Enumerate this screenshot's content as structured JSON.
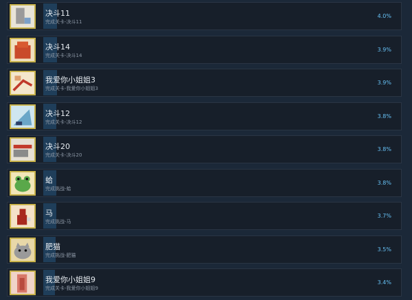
{
  "achievements": [
    {
      "title": "决斗11",
      "desc": "完成关卡-决斗11",
      "percent": "4.0%",
      "icon": "duel-11-icon",
      "percent_value": 4.0
    },
    {
      "title": "决斗14",
      "desc": "完成关卡-决斗14",
      "percent": "3.9%",
      "icon": "duel-14-icon",
      "percent_value": 3.9
    },
    {
      "title": "我爱你小姐姐3",
      "desc": "完成关卡-我爱你小姐姐3",
      "percent": "3.9%",
      "icon": "love-3-icon",
      "percent_value": 3.9
    },
    {
      "title": "决斗12",
      "desc": "完成关卡-决斗12",
      "percent": "3.8%",
      "icon": "duel-12-icon",
      "percent_value": 3.8
    },
    {
      "title": "决斗20",
      "desc": "完成关卡-决斗20",
      "percent": "3.8%",
      "icon": "duel-20-icon",
      "percent_value": 3.8
    },
    {
      "title": "蛤",
      "desc": "完成挑战-蛤",
      "percent": "3.8%",
      "icon": "frog-icon",
      "percent_value": 3.8
    },
    {
      "title": "马",
      "desc": "完成挑战-马",
      "percent": "3.7%",
      "icon": "horse-icon",
      "percent_value": 3.7
    },
    {
      "title": "肥猫",
      "desc": "完成挑战-肥猫",
      "percent": "3.5%",
      "icon": "fat-cat-icon",
      "percent_value": 3.5
    },
    {
      "title": "我爱你小姐姐9",
      "desc": "完成关卡-我爱你小姐姐9",
      "percent": "3.4%",
      "icon": "love-9-icon",
      "percent_value": 3.4
    }
  ],
  "colors": {
    "accent": "#66c0f4",
    "background": "#1b2838",
    "row": "#171f2a",
    "progress": "#1f3e5a"
  }
}
